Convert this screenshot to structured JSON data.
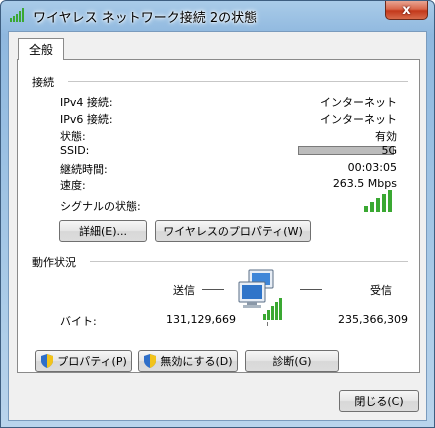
{
  "window": {
    "title": "ワイヤレス ネットワーク接続 2の状態",
    "close_glyph": "x"
  },
  "tabs": [
    {
      "label": "全般",
      "active": true
    }
  ],
  "connection": {
    "section_title": "接続",
    "rows": [
      {
        "label": "IPv4 接続:",
        "value": "インターネット"
      },
      {
        "label": "IPv6 接続:",
        "value": "インターネット"
      },
      {
        "label": "状態:",
        "value": "有効"
      },
      {
        "label": "SSID:",
        "value": "5G",
        "redacted": true
      },
      {
        "label": "継続時間:",
        "value": "00:03:05"
      },
      {
        "label": "速度:",
        "value": "263.5 Mbps"
      }
    ],
    "signal_label": "シグナルの状態:",
    "signal_bars": 5,
    "details_button": "詳細(E)...",
    "wireless_props_button": "ワイヤレスのプロパティ(W)"
  },
  "activity": {
    "section_title": "動作状況",
    "sent_label": "送信",
    "received_label": "受信",
    "bytes_label": "バイト:",
    "bytes_sent": "131,129,669",
    "bytes_received": "235,366,309"
  },
  "actions": {
    "properties_button": "プロパティ(P)",
    "disable_button": "無効にする(D)",
    "diagnose_button": "診断(G)"
  },
  "footer": {
    "close_button": "閉じる(C)"
  },
  "colors": {
    "signal": "#3aa832",
    "shield_blue": "#2f6fc9",
    "shield_yellow": "#f2c31a"
  }
}
